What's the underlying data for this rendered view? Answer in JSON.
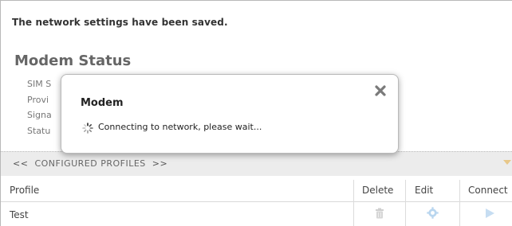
{
  "notice": {
    "message": "The network settings have been saved."
  },
  "modem_status": {
    "title": "Modem Status",
    "labels": [
      "SIM S",
      "Provi",
      "Signa",
      "Statu"
    ]
  },
  "profiles_bar": {
    "prev": "<<",
    "label": "CONFIGURED PROFILES",
    "next": ">>"
  },
  "table": {
    "columns": {
      "profile": "Profile",
      "delete": "Delete",
      "edit": "Edit",
      "connect": "Connect"
    },
    "rows": [
      {
        "profile": "Test"
      }
    ]
  },
  "dialog": {
    "title": "Modem",
    "message": "Connecting to network, please wait...",
    "close_icon": "close-icon",
    "spinner_icon": "spinner-icon"
  },
  "icons": {
    "delete": "trash-icon",
    "edit": "gear-icon",
    "connect": "play-icon"
  },
  "colors": {
    "icon_disabled": "#cfcfcf",
    "edit_icon": "#b9d6ef",
    "connect_icon": "#c6ddf2",
    "bar_marker": "#e8c88a"
  }
}
